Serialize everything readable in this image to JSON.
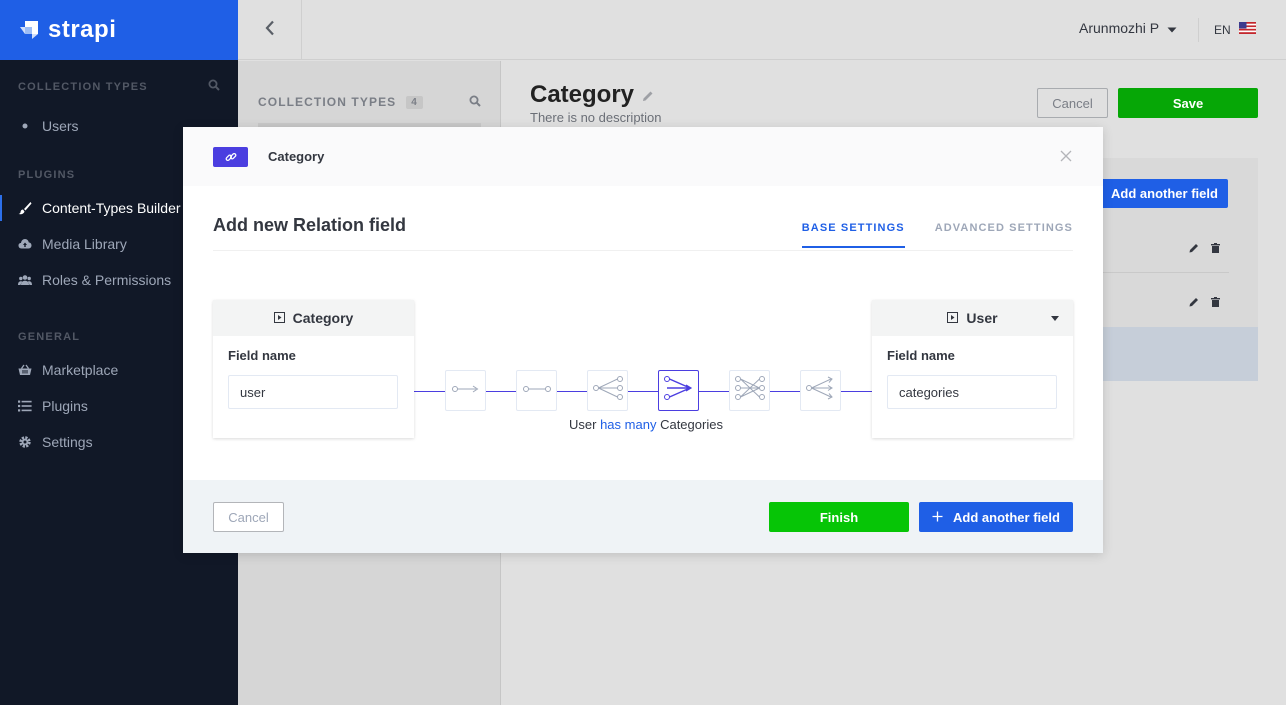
{
  "brand": {
    "name": "strapi"
  },
  "leftnav": {
    "collection_types_title": "COLLECTION TYPES",
    "collection_items": [
      {
        "label": "Users"
      }
    ],
    "plugins_title": "PLUGINS",
    "plugins": [
      {
        "label": "Content-Types Builder",
        "icon": "brush-icon"
      },
      {
        "label": "Media Library",
        "icon": "cloud-upload-icon"
      },
      {
        "label": "Roles & Permissions",
        "icon": "users-icon"
      }
    ],
    "general_title": "GENERAL",
    "general": [
      {
        "label": "Marketplace",
        "icon": "basket-icon"
      },
      {
        "label": "Plugins",
        "icon": "list-icon"
      },
      {
        "label": "Settings",
        "icon": "gear-icon"
      }
    ]
  },
  "header": {
    "user_name": "Arunmozhi P",
    "language": "EN"
  },
  "subnav": {
    "title": "COLLECTION TYPES",
    "count": "4"
  },
  "main": {
    "title": "Category",
    "description": "There is no description",
    "cancel_label": "Cancel",
    "save_label": "Save",
    "add_field_label": "Add another field"
  },
  "modal": {
    "header_title": "Category",
    "title": "Add new Relation field",
    "tabs": [
      {
        "label": "BASE SETTINGS"
      },
      {
        "label": "ADVANCED SETTINGS"
      }
    ],
    "left_box": {
      "title": "Category",
      "field_label": "Field name",
      "field_value": "user"
    },
    "right_box": {
      "title": "User",
      "field_label": "Field name",
      "field_value": "categories"
    },
    "relation_caption": {
      "subject": "User",
      "relation": "has many",
      "object": "Categories"
    },
    "footer": {
      "cancel_label": "Cancel",
      "finish_label": "Finish",
      "add_field_label": "Add another field"
    }
  },
  "colors": {
    "primary": "#1f5fe6",
    "success": "#06c506",
    "relation": "#4b3ee0",
    "nav_bg": "#111827"
  }
}
